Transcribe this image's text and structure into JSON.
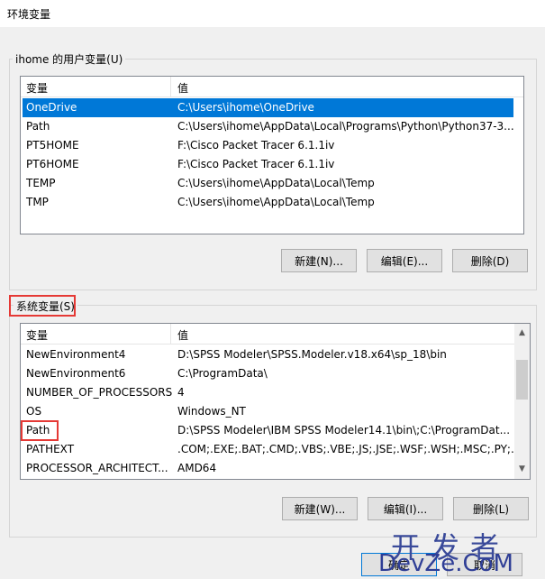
{
  "window": {
    "title": "环境变量"
  },
  "user_vars": {
    "group_label": "ihome 的用户变量(U)",
    "col_name": "变量",
    "col_value": "值",
    "rows": [
      {
        "name": "OneDrive",
        "value": "C:\\Users\\ihome\\OneDrive"
      },
      {
        "name": "Path",
        "value": "C:\\Users\\ihome\\AppData\\Local\\Programs\\Python\\Python37-3..."
      },
      {
        "name": "PT5HOME",
        "value": "F:\\Cisco Packet Tracer 6.1.1iv"
      },
      {
        "name": "PT6HOME",
        "value": "F:\\Cisco Packet Tracer 6.1.1iv"
      },
      {
        "name": "TEMP",
        "value": "C:\\Users\\ihome\\AppData\\Local\\Temp"
      },
      {
        "name": "TMP",
        "value": "C:\\Users\\ihome\\AppData\\Local\\Temp"
      }
    ],
    "new_label": "新建(N)...",
    "edit_label": "编辑(E)...",
    "delete_label": "删除(D)"
  },
  "system_vars": {
    "group_label": "系统变量(S)",
    "col_name": "变量",
    "col_value": "值",
    "rows": [
      {
        "name": "NewEnvironment4",
        "value": "D:\\SPSS Modeler\\SPSS.Modeler.v18.x64\\sp_18\\bin"
      },
      {
        "name": "NewEnvironment6",
        "value": "C:\\ProgramData\\"
      },
      {
        "name": "NUMBER_OF_PROCESSORS",
        "value": "4"
      },
      {
        "name": "OS",
        "value": "Windows_NT"
      },
      {
        "name": "Path",
        "value": "D:\\SPSS Modeler\\IBM SPSS Modeler14.1\\bin\\;C:\\ProgramDat..."
      },
      {
        "name": "PATHEXT",
        "value": ".COM;.EXE;.BAT;.CMD;.VBS;.VBE;.JS;.JSE;.WSF;.WSH;.MSC;.PY;.P..."
      },
      {
        "name": "PROCESSOR_ARCHITECT...",
        "value": "AMD64"
      }
    ],
    "new_label": "新建(W)...",
    "edit_label": "编辑(I)...",
    "delete_label": "删除(L)"
  },
  "footer": {
    "ok_label": "确定",
    "cancel_label": "取消"
  },
  "watermark": {
    "line1": "开发者",
    "line2": "DevZe.CoM"
  },
  "colors": {
    "selection": "#0078d7",
    "highlight": "#e53935"
  }
}
